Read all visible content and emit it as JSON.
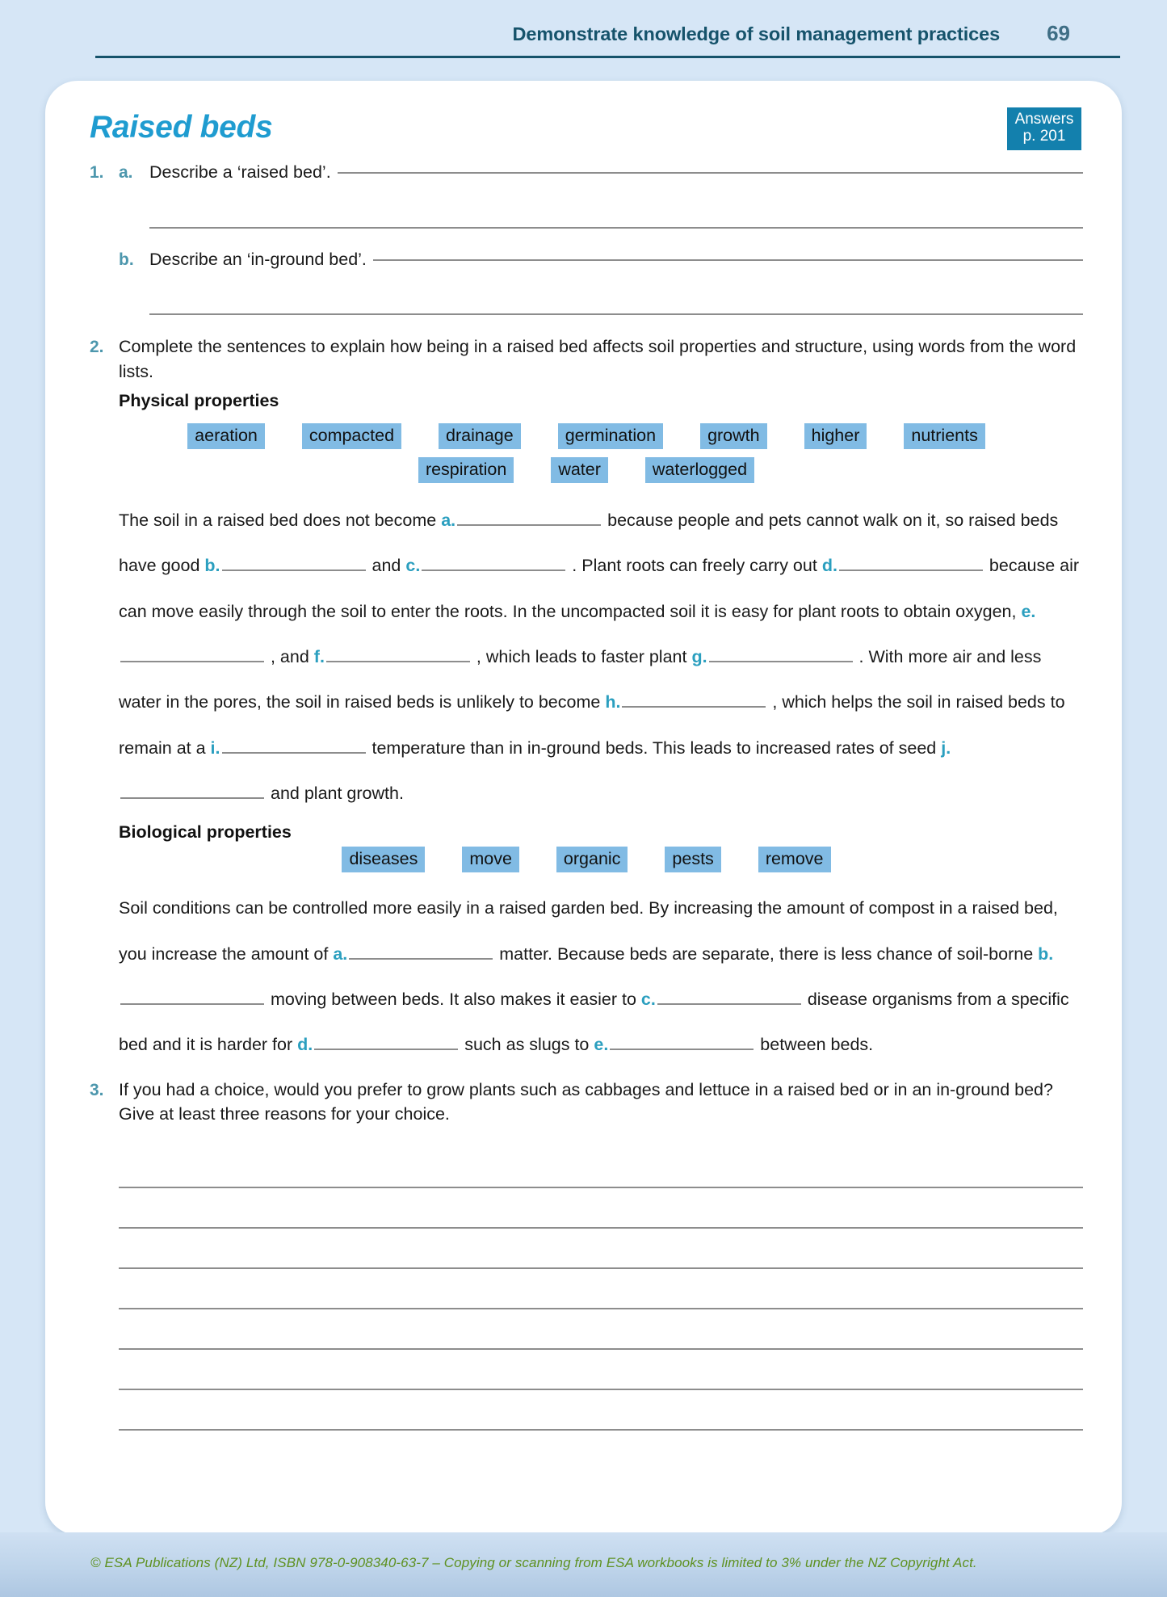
{
  "header": {
    "title": "Demonstrate knowledge of soil management practices",
    "page_number": "69"
  },
  "section": {
    "title": "Raised beds",
    "answers_badge": {
      "line1": "Answers",
      "line2": "p. 201"
    }
  },
  "questions": {
    "q1": {
      "number": "1.",
      "parts": [
        {
          "letter": "a.",
          "text": "Describe a ‘raised bed’."
        },
        {
          "letter": "b.",
          "text": "Describe an ‘in-ground bed’."
        }
      ]
    },
    "q2": {
      "number": "2.",
      "text": "Complete the sentences to explain how being in a raised bed affects soil properties and structure, using words from the word lists."
    },
    "q3": {
      "number": "3.",
      "text": "If you had a choice, would you prefer to grow plants such as cabbages and lettuce in a raised bed or in an in-ground bed? Give at least three reasons for your choice.",
      "answer_line_count": 7
    }
  },
  "physical": {
    "heading": "Physical properties",
    "words_row1": [
      "aeration",
      "compacted",
      "drainage",
      "germination",
      "growth",
      "higher",
      "nutrients"
    ],
    "words_row2": [
      "respiration",
      "water",
      "waterlogged"
    ],
    "sentence": {
      "s1": "The soil in a raised bed does not become",
      "a": "a.",
      "s2": "because people and pets cannot walk on it, so raised beds have good",
      "b": "b.",
      "s3": "and",
      "c": "c.",
      "s4": ". Plant roots can freely carry out",
      "d": "d.",
      "s5": "because air can move easily through the soil to enter the roots. In the uncompacted soil it is easy for plant roots to obtain oxygen,",
      "e": "e.",
      "s6": ", and",
      "f": "f.",
      "s7": ", which leads to faster plant",
      "g": "g.",
      "s8": ". With more air and less water in the pores, the soil in raised beds is unlikely to become",
      "h": "h.",
      "s9": ", which helps the soil in raised beds to remain at a",
      "i": "i.",
      "s10": "temperature than in in-ground beds. This leads to increased rates of seed",
      "j": "j.",
      "s11": "and plant growth."
    }
  },
  "biological": {
    "heading": "Biological properties",
    "words": [
      "diseases",
      "move",
      "organic",
      "pests",
      "remove"
    ],
    "sentence": {
      "s1": "Soil conditions can be controlled more easily in a raised garden bed. By increasing the amount of compost in a raised bed, you increase the amount of",
      "a": "a.",
      "s2": "matter. Because beds are separate, there is less chance of soil-borne",
      "b": "b.",
      "s3": "moving between beds. It also makes it easier to",
      "c": "c.",
      "s4": "disease organisms from a specific bed and it is harder for",
      "d": "d.",
      "s5": "such as slugs to",
      "e": "e.",
      "s6": "between beds."
    }
  },
  "footer": {
    "text": "© ESA Publications (NZ) Ltd, ISBN 978-0-908340-63-7 –  Copying or scanning from ESA workbooks is limited to 3% under the NZ Copyright Act."
  },
  "colors": {
    "page_background": "#d6e6f6",
    "header_text": "#16536b",
    "title_accent": "#1f9cd0",
    "label_accent": "#2b9fbf",
    "chip_background": "#81bbe4",
    "badge_background": "#1380ad",
    "footer_text": "#5e9121",
    "rule_line": "#8d8d8d"
  }
}
